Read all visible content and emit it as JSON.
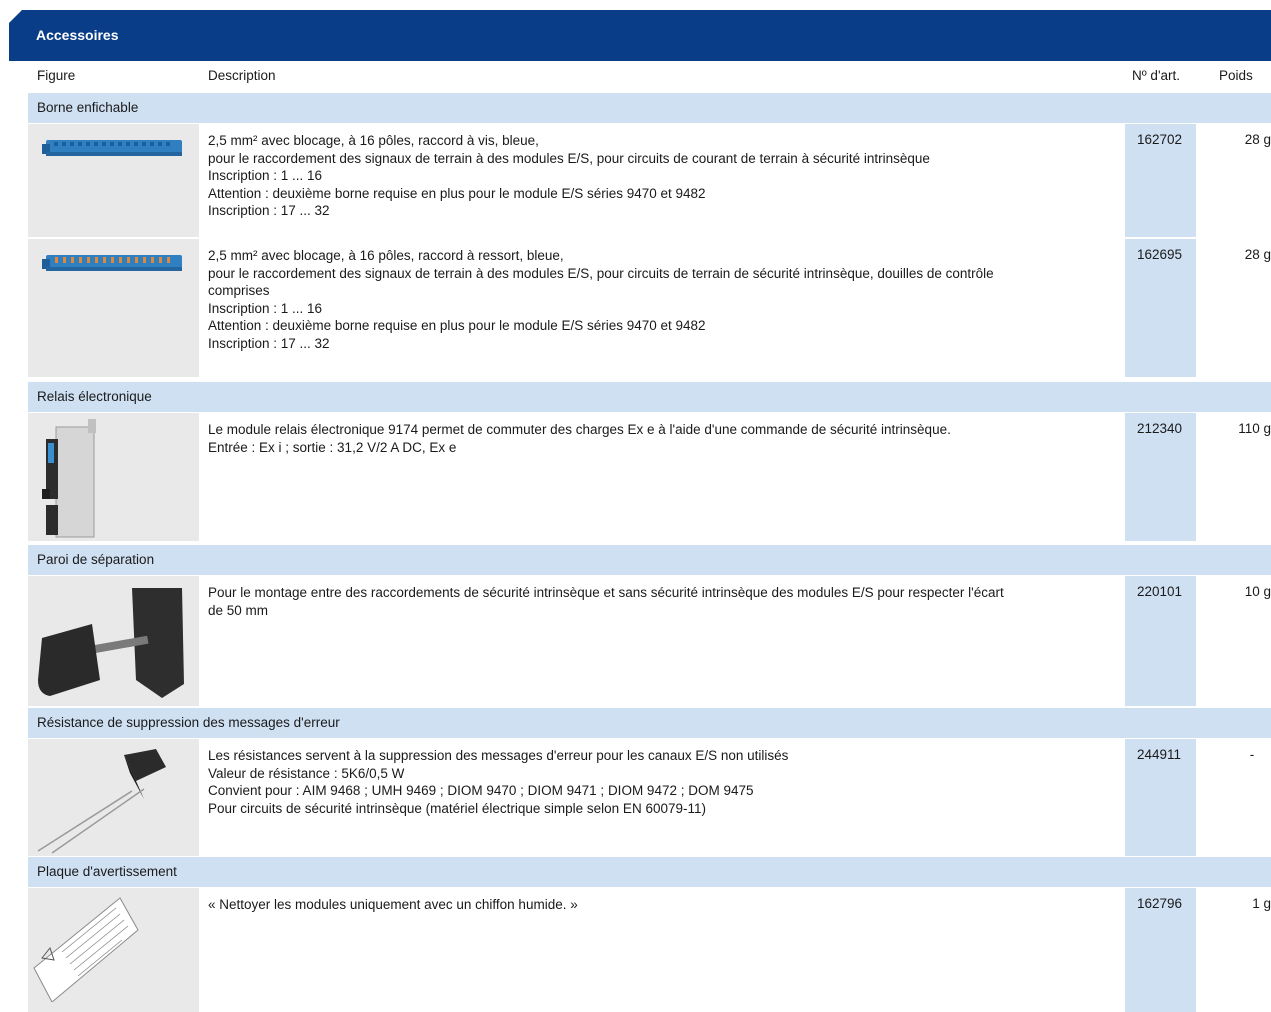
{
  "header": {
    "title": "Accessoires"
  },
  "columns": {
    "figure": "Figure",
    "description": "Description",
    "art": "Nº d'art.",
    "weight": "Poids"
  },
  "categories": [
    {
      "label": "Borne enfichable"
    },
    {
      "label": "Relais électronique"
    },
    {
      "label": "Paroi de séparation"
    },
    {
      "label": "Résistance de suppression des messages d'erreur"
    },
    {
      "label": "Plaque d'avertissement"
    }
  ],
  "rows": [
    {
      "lines": [
        "2,5 mm² avec blocage, à 16 pôles, raccord à vis, bleue,",
        "pour le raccordement des signaux de terrain à des modules E/S, pour circuits de courant de terrain à sécurité intrinsèque",
        "Inscription : 1 ... 16",
        "Attention : deuxième borne requise en plus pour le module E/S séries 9470 et 9482",
        "Inscription : 17 ... 32"
      ],
      "art": "162702",
      "weight": "28 g",
      "image": "blue-terminal-block-screw"
    },
    {
      "lines": [
        "2,5 mm² avec blocage, à 16 pôles, raccord à ressort, bleue,",
        "pour le raccordement des signaux de terrain à des modules E/S, pour circuits de terrain de sécurité intrinsèque, douilles de contrôle",
        "comprises",
        "Inscription : 1 ... 16",
        "Attention : deuxième borne requise en plus pour le module E/S séries 9470 et 9482",
        "Inscription : 17 ... 32"
      ],
      "art": "162695",
      "weight": "28 g",
      "image": "blue-terminal-block-spring"
    },
    {
      "lines": [
        "Le module relais électronique 9174 permet de commuter des charges Ex e à l'aide d'une commande de sécurité intrinsèque.",
        "Entrée : Ex i ; sortie : 31,2 V/2 A DC, Ex e"
      ],
      "art": "212340",
      "weight": "110 g",
      "image": "relay-module"
    },
    {
      "lines": [
        "Pour le montage entre des raccordements de sécurité intrinsèque et sans sécurité intrinsèque des modules E/S pour respecter l'écart",
        "de 50 mm"
      ],
      "art": "220101",
      "weight": "10 g",
      "image": "separation-wall"
    },
    {
      "lines": [
        "Les résistances servent à la suppression des messages d'erreur pour les canaux E/S non utilisés",
        "Valeur de résistance : 5K6/0,5 W",
        "Convient pour : AIM 9468 ; UMH 9469 ; DIOM 9470 ; DIOM 9471 ; DIOM 9472 ; DOM 9475",
        "Pour circuits de sécurité intrinsèque (matériel électrique simple selon EN 60079-11)"
      ],
      "art": "244911",
      "weight": "-",
      "image": "resistor"
    },
    {
      "lines": [
        "« Nettoyer les modules uniquement avec un chiffon humide. »"
      ],
      "art": "162796",
      "weight": "1 g",
      "image": "warning-label"
    }
  ]
}
